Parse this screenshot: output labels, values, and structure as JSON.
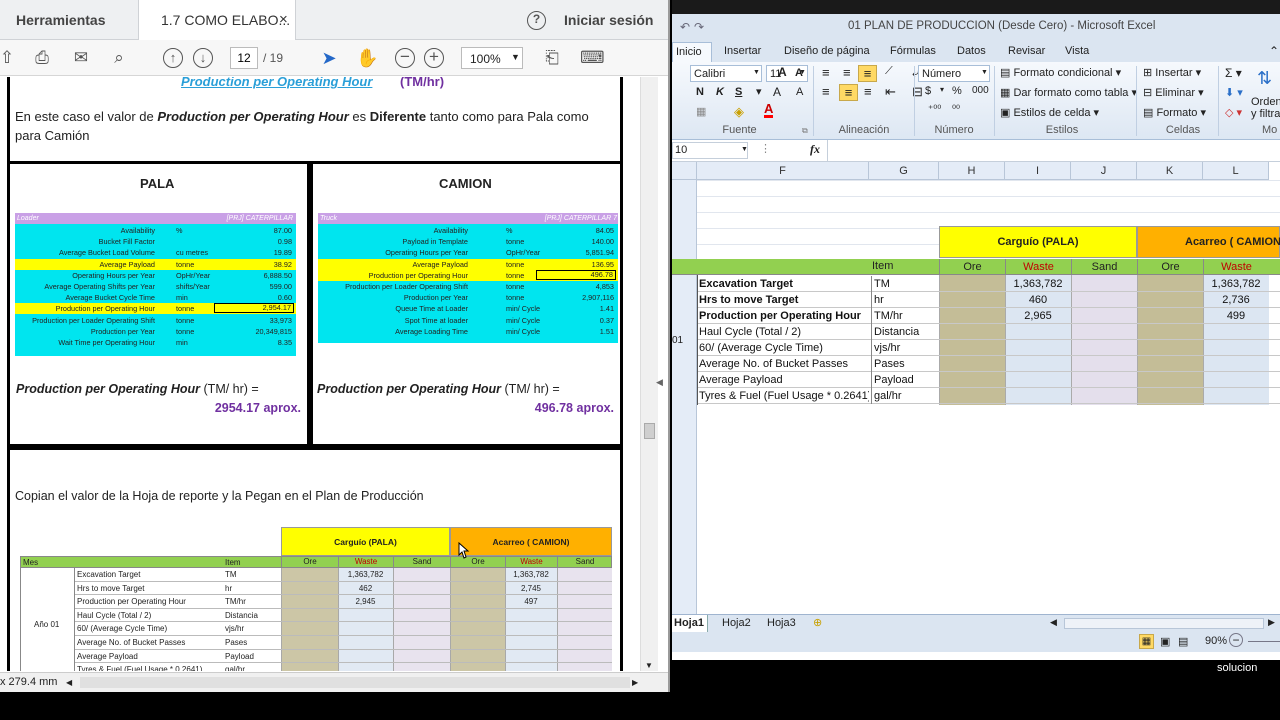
{
  "pdf": {
    "tabs": {
      "tools": "Herramientas",
      "doc": "1.7 COMO ELABO...",
      "signin": "Iniciar sesión",
      "help": "?",
      "close": "×"
    },
    "toolbar": {
      "page_current": "12",
      "page_total": "/ 19",
      "zoom": "100%"
    },
    "status": {
      "size": "x 279.4 mm"
    },
    "heading_partial": "Production per Operating Hour",
    "heading_unit": "(TM/hr)",
    "intro": {
      "p1": "En este caso el valor de ",
      "p2": "Production per Operating Hour",
      "p3": " es ",
      "p4": "Diferente",
      "p5": " tanto como para Pala como",
      "line2": "para Camión"
    },
    "pala": {
      "title": "PALA",
      "head_left": "Loader",
      "head_right": "[PRJ] CATERPILLAR",
      "rows": [
        {
          "label": "Availability",
          "unit": "%",
          "value": "87.00",
          "hl": false
        },
        {
          "label": "Bucket Fill Factor",
          "unit": "",
          "value": "0.98",
          "hl": false
        },
        {
          "label": "Average Bucket Load Volume",
          "unit": "cu metres",
          "value": "19.89",
          "hl": false
        },
        {
          "label": "Average Payload",
          "unit": "tonne",
          "value": "38.92",
          "hl": true
        },
        {
          "label": "Operating Hours per Year",
          "unit": "OpHr/Year",
          "value": "6,888.50",
          "hl": false
        },
        {
          "label": "Average Operating Shifts per Year",
          "unit": "shifts/Year",
          "value": "599.00",
          "hl": false
        },
        {
          "label": "Average Bucket Cycle Time",
          "unit": "min",
          "value": "0.60",
          "hl": false
        },
        {
          "label": "Production per Operating Hour",
          "unit": "tonne",
          "value": "2,954.17",
          "hl": true
        },
        {
          "label": "Production per Loader Operating Shift",
          "unit": "tonne",
          "value": "33,973",
          "hl": false
        },
        {
          "label": "Production per Year",
          "unit": "tonne",
          "value": "20,349,815",
          "hl": false
        },
        {
          "label": "Wait Time per Operating Hour",
          "unit": "min",
          "value": "8.35",
          "hl": false
        }
      ],
      "result_label": "Production per Operating Hour",
      "result_unit": " (TM/ hr) =",
      "result_value": "2954.17 aprox."
    },
    "camion": {
      "title": "CAMION",
      "head_left": "Truck",
      "head_right": "[PRJ] CATERPILLAR 7",
      "rows": [
        {
          "label": "Availability",
          "unit": "%",
          "value": "84.05",
          "hl": false
        },
        {
          "label": "Payload in Template",
          "unit": "tonne",
          "value": "140.00",
          "hl": false
        },
        {
          "label": "Operating Hours per Year",
          "unit": "OpHr/Year",
          "value": "5,851.94",
          "hl": false
        },
        {
          "label": "Average Payload",
          "unit": "tonne",
          "value": "136.95",
          "hl": true
        },
        {
          "label": "Production per Operating Hour",
          "unit": "tonne",
          "value": "496.78",
          "hl": true
        },
        {
          "label": "Production per Loader Operating Shift",
          "unit": "tonne",
          "value": "4,853",
          "hl": false
        },
        {
          "label": "Production per Year",
          "unit": "tonne",
          "value": "2,907,116",
          "hl": false
        },
        {
          "label": "Queue Time at Loader",
          "unit": "min/ Cycle",
          "value": "1.41",
          "hl": false
        },
        {
          "label": "Spot Time at loader",
          "unit": "min/ Cycle",
          "value": "0.37",
          "hl": false
        },
        {
          "label": "Average Loading Time",
          "unit": "min/ Cycle",
          "value": "1.51",
          "hl": false
        }
      ],
      "result_label": "Production per Operating Hour",
      "result_unit": " (TM/ hr) =",
      "result_value": "496.78 aprox."
    },
    "copy_text": "Copian el valor de la Hoja de reporte y la Pegan en el Plan de Producción",
    "mini": {
      "carguio": "Carguío (PALA)",
      "acarreo": "Acarreo ( CAMION)",
      "h_mes": "Mes",
      "h_item": "Item",
      "cols": [
        "Ore",
        "Waste",
        "Sand",
        "Ore",
        "Waste",
        "Sand"
      ],
      "year": "Año 01",
      "rows": [
        {
          "label": "Excavation Target",
          "item": "TM",
          "pala_waste": "1,363,782",
          "cam_waste": "1,363,782"
        },
        {
          "label": "Hrs to move Target",
          "item": "hr",
          "pala_waste": "462",
          "cam_waste": "2,745"
        },
        {
          "label": "Production per Operating Hour",
          "item": "TM/hr",
          "pala_waste": "2,945",
          "cam_waste": "497"
        },
        {
          "label": "Haul Cycle (Total / 2)",
          "item": "Distancia",
          "pala_waste": "",
          "cam_waste": ""
        },
        {
          "label": "60/ (Average Cycle Time)",
          "item": "vjs/hr",
          "pala_waste": "",
          "cam_waste": ""
        },
        {
          "label": "Average No. of Bucket Passes",
          "item": "Pases",
          "pala_waste": "",
          "cam_waste": ""
        },
        {
          "label": "Average Payload",
          "item": "Payload",
          "pala_waste": "",
          "cam_waste": ""
        },
        {
          "label": "Tyres & Fuel (Fuel Usage * 0.2641)",
          "item": "gal/hr",
          "pala_waste": "",
          "cam_waste": ""
        }
      ]
    }
  },
  "excel": {
    "title": "01 PLAN DE PRODUCCION (Desde Cero)  -  Microsoft Excel",
    "ribbon_tabs": [
      "Inicio",
      "Insertar",
      "Diseño de página",
      "Fórmulas",
      "Datos",
      "Revisar",
      "Vista"
    ],
    "font_name": "Calibri",
    "font_size": "11",
    "number_format": "Número",
    "groups": {
      "fuente": "Fuente",
      "alineacion": "Alineación",
      "numero": "Número",
      "estilos": "Estilos",
      "celdas": "Celdas",
      "mo": "Mo"
    },
    "styles_btns": {
      "cond": "Formato condicional",
      "table": "Dar formato como tabla",
      "cell": "Estilos de celda"
    },
    "cells_btns": {
      "insert": "Insertar",
      "delete": "Eliminar",
      "format": "Formato"
    },
    "edit_btns": {
      "sort": "Ordenar",
      "filter": "y filtrar"
    },
    "name_box": "10",
    "fx": "fx",
    "col_headers": [
      "F",
      "G",
      "H",
      "I",
      "J",
      "K",
      "L"
    ],
    "carguio": "Carguío (PALA)",
    "acarreo": "Acarreo ( CAMION)",
    "item_header": "Item",
    "sub_cols": [
      "Ore",
      "Waste",
      "Sand",
      "Ore",
      "Waste"
    ],
    "row_marker": "01",
    "rows": [
      {
        "label": "Excavation Target",
        "bold": true,
        "item": "TM",
        "i": "1,363,782",
        "l": "1,363,782"
      },
      {
        "label": "Hrs to move Target",
        "bold": true,
        "item": "hr",
        "i": "460",
        "l": "2,736"
      },
      {
        "label": "Production per Operating Hour",
        "bold": true,
        "item": "TM/hr",
        "i": "2,965",
        "l": "499"
      },
      {
        "label": "Haul Cycle (Total / 2)",
        "bold": false,
        "item": "Distancia",
        "i": "",
        "l": ""
      },
      {
        "label": "60/ (Average Cycle Time)",
        "bold": false,
        "item": "vjs/hr",
        "i": "",
        "l": ""
      },
      {
        "label": "Average No. of Bucket Passes",
        "bold": false,
        "item": "Pases",
        "i": "",
        "l": ""
      },
      {
        "label": "Average Payload",
        "bold": false,
        "item": "Payload",
        "i": "",
        "l": ""
      },
      {
        "label": "Tyres & Fuel (Fuel Usage * 0.2641)",
        "bold": false,
        "item": "gal/hr",
        "i": "",
        "l": ""
      }
    ],
    "sheets": [
      "Hoja1",
      "Hoja2",
      "Hoja3"
    ],
    "zoom": "90%"
  },
  "taskbar": {
    "label": "solucion"
  },
  "colors": {
    "cyan": "#00e5ef",
    "lilac": "#c9a0e6",
    "yellow": "#ffff00",
    "orange": "#ffb000",
    "green": "#92d050",
    "olive": "#c4bd97",
    "ltblue": "#dce6f2",
    "lavender": "#e4dfec",
    "purple": "#7030a0"
  }
}
